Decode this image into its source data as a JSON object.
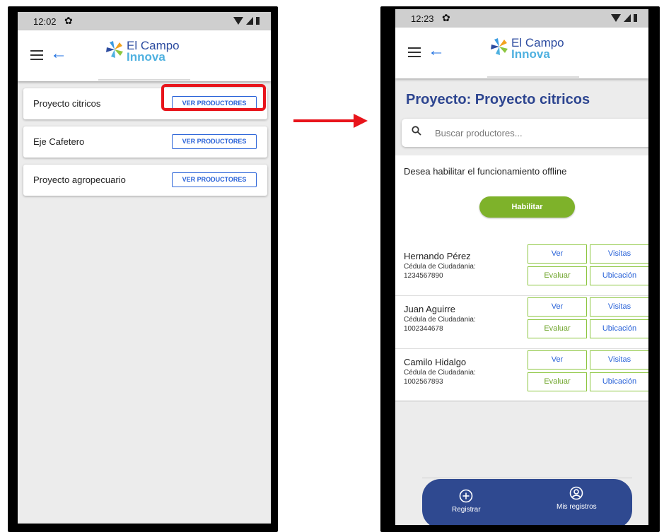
{
  "left_phone": {
    "status": {
      "time": "12:02"
    },
    "logo": {
      "line1": "El Campo",
      "line2": "Innova"
    },
    "projects": [
      {
        "name": "Proyecto citricos",
        "button": "VER PRODUCTORES"
      },
      {
        "name": "Eje Cafetero",
        "button": "VER PRODUCTORES"
      },
      {
        "name": "Proyecto agropecuario",
        "button": "VER PRODUCTORES"
      }
    ]
  },
  "right_phone": {
    "status": {
      "time": "12:23"
    },
    "logo": {
      "line1": "El Campo",
      "line2": "Innova"
    },
    "page_title": "Proyecto: Proyecto citricos",
    "search": {
      "placeholder": "Buscar productores..."
    },
    "offline": {
      "question": "Desea habilitar el funcionamiento offline",
      "button": "Habilitar"
    },
    "producers": [
      {
        "name": "Hernando Pérez",
        "id_label": "Cédula de Ciudadania:",
        "id_number": "1234567890"
      },
      {
        "name": "Juan Aguirre",
        "id_label": "Cédula de Ciudadania:",
        "id_number": "1002344678"
      },
      {
        "name": "Camilo Hidalgo",
        "id_label": "Cédula de Ciudadania:",
        "id_number": "1002567893"
      }
    ],
    "actions": {
      "ver": "Ver",
      "visitas": "Visitas",
      "evaluar": "Evaluar",
      "ubicacion": "Ubicación"
    },
    "bottom_nav": {
      "registrar": "Registrar",
      "mis_registros": "Mis registros"
    }
  },
  "colors": {
    "primary_blue": "#2d4590",
    "link_blue": "#2a63d8",
    "green": "#7eb22a",
    "highlight_red": "#e8141b"
  },
  "icons": [
    "menu-icon",
    "back-arrow-icon",
    "gear-icon",
    "wifi-icon",
    "signal-icon",
    "battery-icon",
    "search-icon",
    "plus-circle-icon",
    "user-circle-icon",
    "logo-icon"
  ]
}
